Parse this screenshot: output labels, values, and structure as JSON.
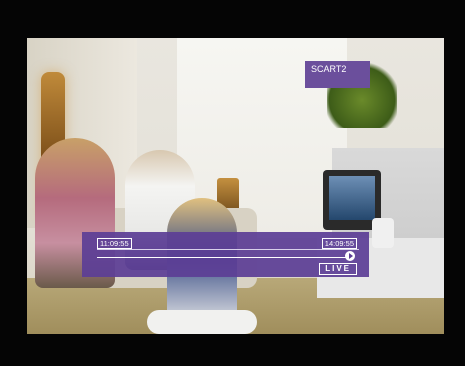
{
  "source": {
    "label": "SCART2"
  },
  "timeshift": {
    "start_time": "11:09:55",
    "end_time": "14:09:55",
    "live_label": "LIVE",
    "play_icon": "play-icon"
  },
  "colors": {
    "osd_purple": "#5c3e96",
    "osd_text": "#ffffff"
  }
}
